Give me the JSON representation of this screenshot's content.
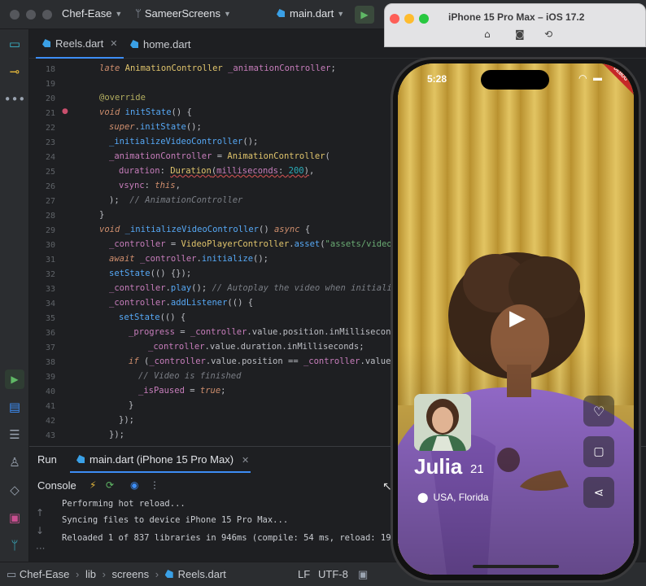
{
  "titlebar": {
    "project": "Chef-Ease",
    "branch": "SameerScreens",
    "run_config": "main.dart"
  },
  "tabs": [
    {
      "label": "Reels.dart",
      "active": true
    },
    {
      "label": "home.dart",
      "active": false
    }
  ],
  "editor": {
    "line_numbers": [
      "18",
      "19",
      "20",
      "21",
      "22",
      "23",
      "24",
      "25",
      "26",
      "27",
      "28",
      "29",
      "30",
      "31",
      "32",
      "33",
      "34",
      "35",
      "36",
      "37",
      "38",
      "39",
      "40",
      "41",
      "42",
      "43"
    ]
  },
  "run_panel": {
    "run_label": "Run",
    "tab_label": "main.dart (iPhone 15 Pro Max)",
    "console_label": "Console",
    "lines": [
      "Performing hot reload...",
      "Syncing files to device iPhone 15 Pro Max...",
      "Reloaded 1 of 837 libraries in 946ms (compile: 54 ms, reload: 199 m"
    ]
  },
  "statusbar": {
    "crumbs": [
      "Chef-Ease",
      "lib",
      "screens",
      "Reels.dart"
    ],
    "line_ending": "LF",
    "encoding": "UTF-8"
  },
  "simulator": {
    "title": "iPhone 15 Pro Max – iOS 17.2",
    "time": "5:28",
    "debug_badge": "DEBUG",
    "profile_name": "Julia",
    "profile_age": "21",
    "location": "USA, Florida"
  },
  "colors": {
    "accent": "#3d8df5",
    "run_green": "#4caf50",
    "curtain": "#d6b34e",
    "shirt": "#9a6fd3",
    "debug_red": "#c62828"
  }
}
